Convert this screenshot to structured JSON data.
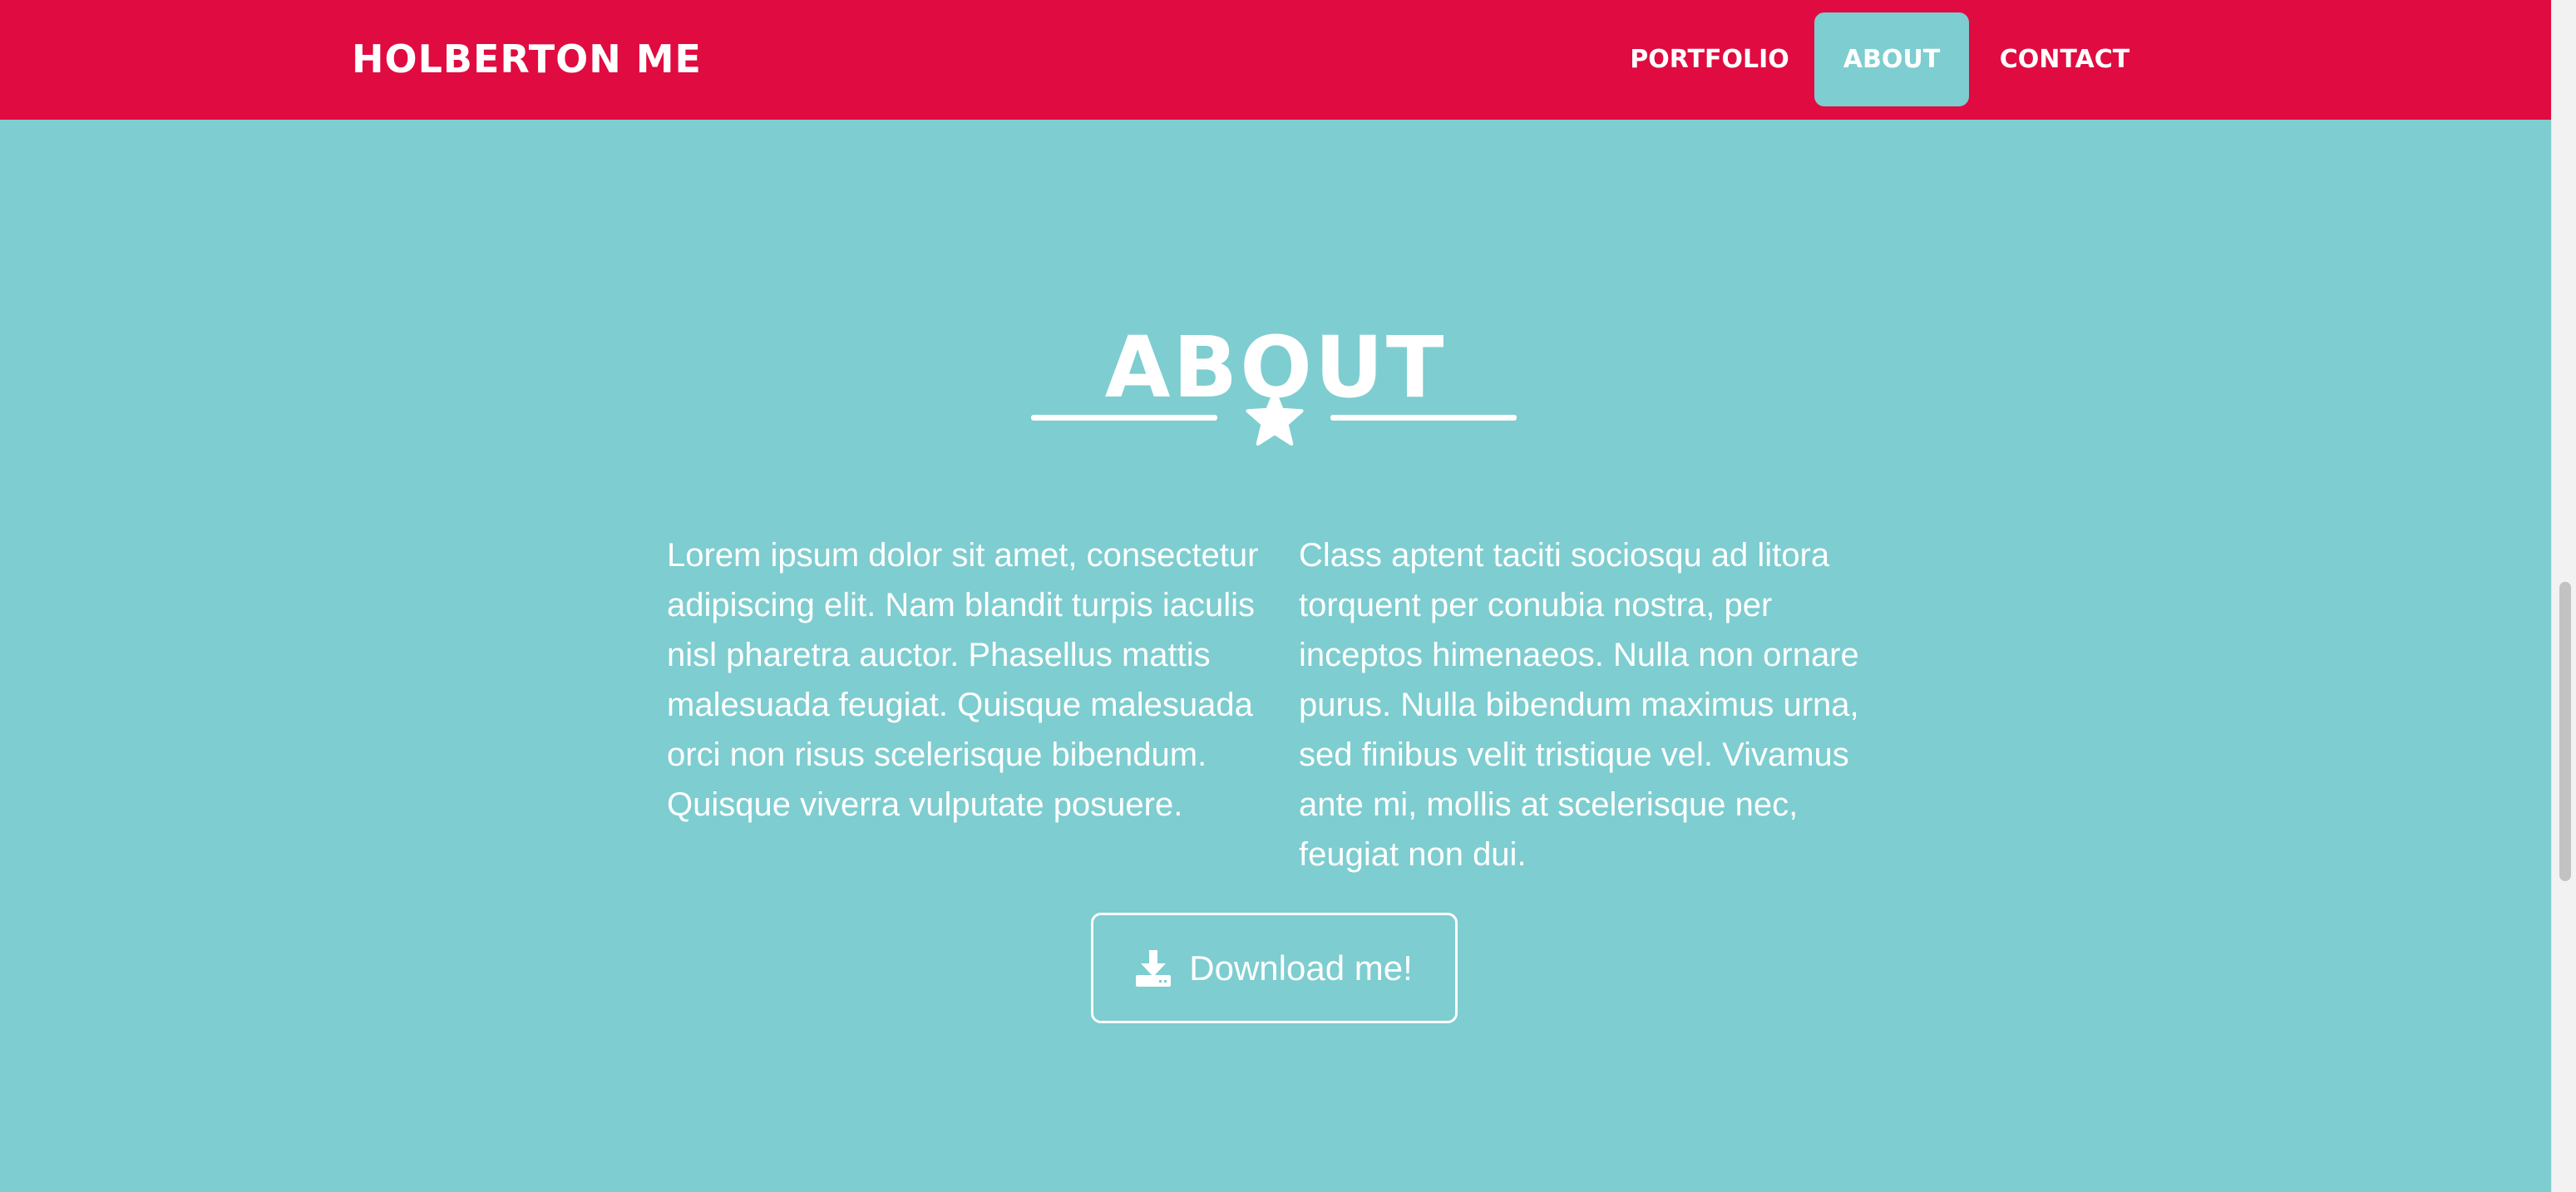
{
  "navbar": {
    "brand": "HOLBERTON ME",
    "links": [
      {
        "label": "PORTFOLIO",
        "active": false
      },
      {
        "label": "ABOUT",
        "active": true
      },
      {
        "label": "CONTACT",
        "active": false
      }
    ]
  },
  "about": {
    "title": "ABOUT",
    "divider_icon": "star-icon",
    "left_paragraph": "Lorem ipsum dolor sit amet, consectetur adipiscing elit. Nam blandit turpis iaculis nisl pharetra auctor. Phasellus mattis malesuada feugiat. Quisque malesuada orci non risus scelerisque bibendum. Quisque viverra vulputate posuere.",
    "right_paragraph": "Class aptent taciti sociosqu ad litora torquent per conubia nostra, per inceptos himenaeos. Nulla non ornare purus. Nulla bibendum maximus urna, sed finibus velit tristique vel. Vivamus ante mi, mollis at scelerisque nec, feugiat non dui.",
    "download_button": {
      "label": "Download me!",
      "icon": "download-icon"
    }
  },
  "colors": {
    "navbar_bg": "#e00b40",
    "section_bg": "#7ecdd0",
    "text": "#ffffff"
  }
}
